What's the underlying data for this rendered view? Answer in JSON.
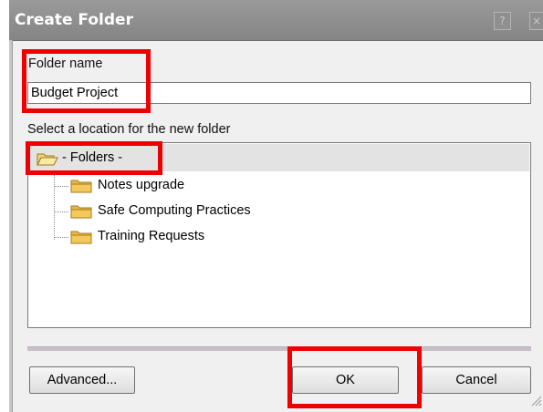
{
  "dialog": {
    "title": "Create Folder",
    "help_glyph": "?",
    "close_glyph": "×",
    "folder_name_label": "Folder name",
    "folder_name_value": "Budget Project",
    "location_label": "Select a location for the new folder",
    "tree": {
      "root_label": "- Folders -",
      "root_icon": "open-folder-icon",
      "children": [
        {
          "label": "Notes upgrade",
          "icon": "folder-icon"
        },
        {
          "label": "Safe Computing Practices",
          "icon": "folder-icon"
        },
        {
          "label": "Training Requests",
          "icon": "folder-icon"
        }
      ]
    },
    "buttons": {
      "advanced": "Advanced...",
      "ok": "OK",
      "cancel": "Cancel"
    }
  },
  "colors": {
    "titlebar": "#8f8f8f",
    "highlight": "#ee0000",
    "folder": "#e8b84a",
    "selection": "#e3e3e3"
  }
}
